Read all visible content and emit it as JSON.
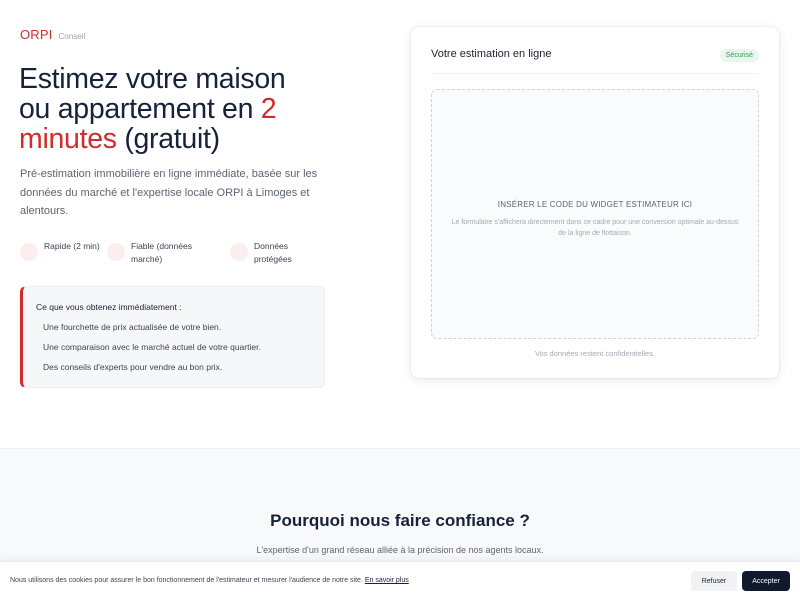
{
  "brand": {
    "logo": "ORPI",
    "tagline": "Conseil",
    "accent_color": "#d12b2b"
  },
  "hero": {
    "headline_line1": "Estimez votre maison",
    "headline_line2_a": "ou appartement en ",
    "headline_line2_b": "2",
    "headline_line3_a": "minutes",
    "headline_line3_b": " (gratuit)",
    "lead": "Pré-estimation immobilière en ligne immédiate, basée sur les données du marché et l'expertise locale ORPI à Limoges et alentours.",
    "features": [
      {
        "label": "Rapide (2 min)"
      },
      {
        "label": "Fiable (données marché)"
      },
      {
        "label": "Données protégées"
      }
    ],
    "benefits": {
      "title": "Ce que vous obtenez immédiatement :",
      "items": [
        "Une fourchette de prix actualisée de votre bien.",
        "Une comparaison avec le marché actuel de votre quartier.",
        "Des conseils d'experts pour vendre au bon prix."
      ]
    }
  },
  "card": {
    "title": "Votre estimation en ligne",
    "badge": "Sécurisé",
    "widget_title": "INSÉRER LE CODE DU WIDGET ESTIMATEUR ICI",
    "widget_desc": "Le formulaire s'affichera directement dans ce cadre pour une conversion optimale au-dessus de la ligne de flottaison.",
    "note": "Vos données restent confidentielles."
  },
  "trust": {
    "title": "Pourquoi nous faire confiance ?",
    "subtitle": "L'expertise d'un grand réseau alliée à la précision de nos agents locaux."
  },
  "cookie": {
    "text": "Nous utilisons des cookies pour assurer le bon fonctionnement de l'estimateur et mesurer l'audience de notre site. ",
    "link": "En savoir plus",
    "refuse": "Refuser",
    "accept": "Accepter"
  }
}
